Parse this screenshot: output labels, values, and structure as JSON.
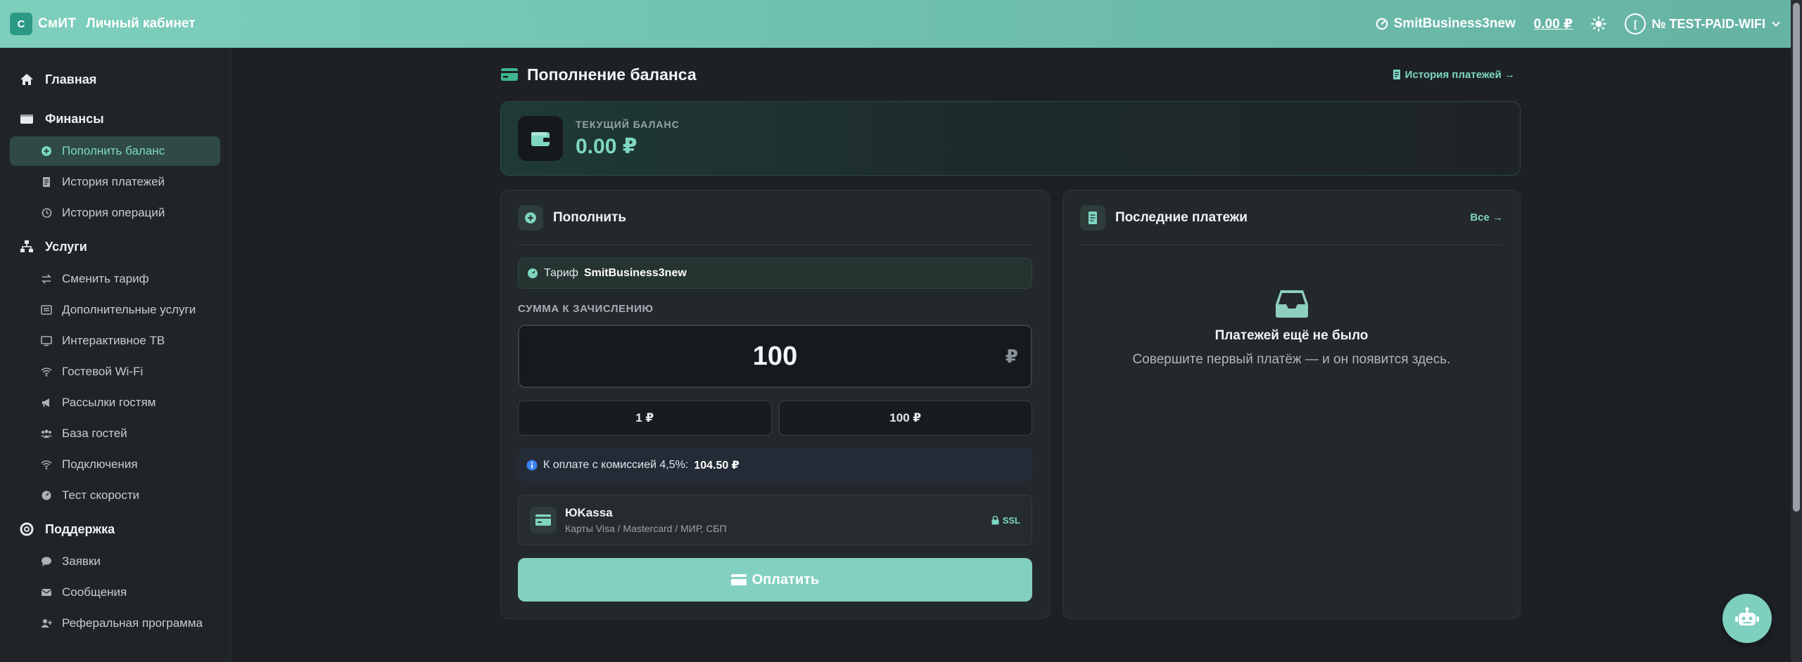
{
  "topbar": {
    "logo_letter": "С",
    "logo_text": "СмИТ",
    "cabinet_label": "Личный кабинет",
    "tariff": "SmitBusiness3new",
    "balance": "0.00 ₽",
    "account": "№ TEST-PAID-WIFI",
    "account_initial": "["
  },
  "sidebar": {
    "home": "Главная",
    "finance": "Финансы",
    "finance_items": [
      "Пополнить баланс",
      "История платежей",
      "История операций"
    ],
    "services": "Услуги",
    "service_items": [
      "Сменить тариф",
      "Дополнительные услуги",
      "Интерактивное ТВ",
      "Гостевой Wi-Fi",
      "Рассылки гостям",
      "База гостей",
      "Подключения",
      "Тест скорости"
    ],
    "support": "Поддержка",
    "support_items": [
      "Заявки",
      "Сообщения",
      "Реферальная программа"
    ]
  },
  "page": {
    "title": "Пополнение баланса",
    "history_link": "История платежей →"
  },
  "balance_card": {
    "label": "ТЕКУЩИЙ БАЛАНС",
    "value": "0.00 ₽"
  },
  "topup": {
    "title": "Пополнить",
    "tariff_prefix": "Тариф",
    "tariff_name": "SmitBusiness3new",
    "amount_label": "СУММА К ЗАЧИСЛЕНИЮ",
    "amount_value": "100",
    "currency": "₽",
    "quick": [
      "1 ₽",
      "100 ₽"
    ],
    "commission_text": "К оплате с комиссией 4,5%:",
    "commission_value": "104.50 ₽",
    "method_name": "ЮKassa",
    "method_sub": "Карты Visa / Mastercard / МИР, СБП",
    "ssl": "SSL",
    "pay_button": "Оплатить"
  },
  "recent": {
    "title": "Последние платежи",
    "all_link": "Все →",
    "empty_title": "Платежей ещё не было",
    "empty_sub": "Совершите первый платёж — и он появится здесь."
  },
  "colors": {
    "accent": "#7ed6c1",
    "topbar": "#6fbfae",
    "background": "#1d2126"
  }
}
